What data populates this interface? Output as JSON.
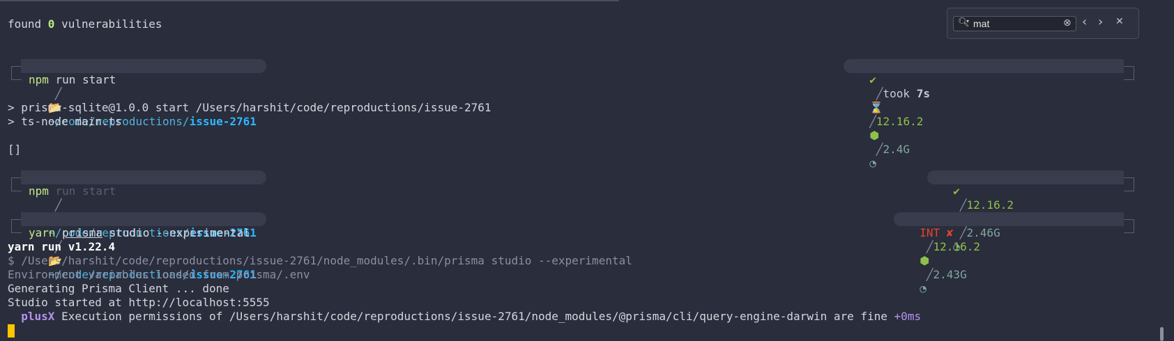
{
  "search": {
    "value": "mat"
  },
  "output": {
    "found_pre": "found ",
    "found_num": "0",
    "found_post": " vulnerabilities",
    "npm_line1": "> prisma-sqlite@1.0.0 start /Users/harshit/code/reproductions/issue-2761",
    "npm_line2": "> ts-node main.ts",
    "array": "[]",
    "yarn_version": "yarn run v1.22.4",
    "yarn_cmd": "$ /Users/harshit/code/reproductions/issue-2761/node_modules/.bin/prisma studio --experimental",
    "env_loaded": "Environment variables loaded from prisma/.env",
    "generating": "Generating Prisma Client ... done",
    "studio_started": "Studio started at http://localhost:5555",
    "plusx_tag": "plusX",
    "plusx_msg": " Execution permissions of /Users/harshit/code/reproductions/issue-2761/node_modules/@prisma/cli/query-engine-darwin are fine ",
    "plusx_time": "+0ms"
  },
  "prompts": [
    {
      "path_prefix": "~/code/reproductions/",
      "path_dir": "issue-2761",
      "cmd": "npm",
      "args": " run start",
      "status": "✔",
      "took_label": "took ",
      "took_value": "7s",
      "node_version": "12.16.2",
      "memory": "2.4G"
    },
    {
      "path_prefix": "~/code/reproductions/",
      "path_dir": "issue-2761",
      "cmd": "npm",
      "args": " run start",
      "status": "✔",
      "node_version": "12.16.2",
      "memory": "2.46G"
    },
    {
      "path_prefix": "~/code/reproductions/",
      "path_dir": "issue-2761",
      "cmd": "yarn",
      "arg_pkg": "prisma",
      "args": " studio --experimental",
      "status": "INT ✘",
      "node_version": "12.16.2",
      "memory": "2.43G"
    }
  ],
  "icons": {
    "os": "apple-icon",
    "folder": "folder-open-icon",
    "hourglass": "hourglass-icon",
    "node": "node-icon",
    "gauge": "gauge-icon",
    "search": "search-icon",
    "clear": "clear-icon",
    "prev": "chevron-left-icon",
    "next": "chevron-right-icon",
    "close": "close-icon"
  },
  "colors": {
    "background": "#2a2d3b",
    "path": "#2fb6ff",
    "ok": "#8fc04a",
    "error": "#e8432e",
    "cursor": "#ffc400",
    "debug_tag": "#b693f0"
  }
}
